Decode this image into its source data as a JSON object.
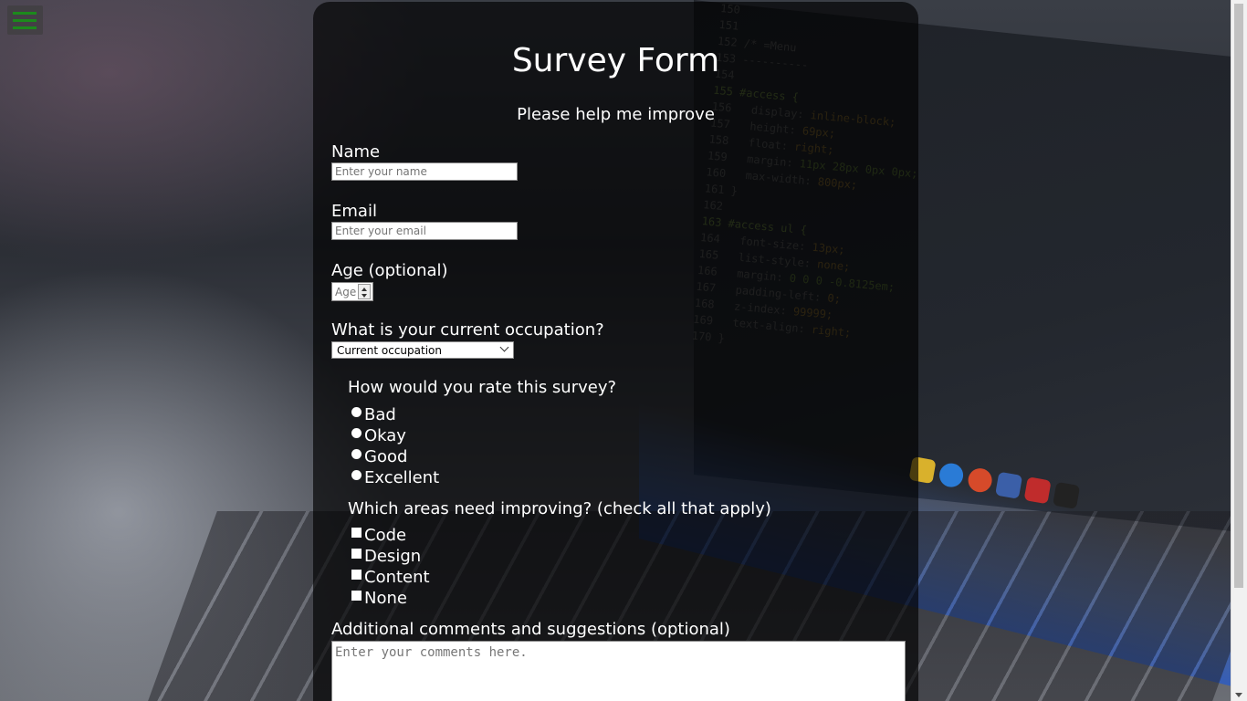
{
  "menu": {
    "icon": "hamburger-icon"
  },
  "form": {
    "title": "Survey Form",
    "subtitle": "Please help me improve",
    "name": {
      "label": "Name",
      "placeholder": "Enter your name"
    },
    "email": {
      "label": "Email",
      "placeholder": "Enter your email"
    },
    "age": {
      "label": "Age (optional)",
      "placeholder": "Age"
    },
    "occupation": {
      "label": "What is your current occupation?",
      "selected": "Current occupation"
    },
    "rating": {
      "question": "How would you rate this survey?",
      "options": [
        "Bad",
        "Okay",
        "Good",
        "Excellent"
      ]
    },
    "improve": {
      "question": "Which areas need improving? (check all that apply)",
      "options": [
        "Code",
        "Design",
        "Content",
        "None"
      ]
    },
    "comments": {
      "label": "Additional comments and suggestions (optional)",
      "placeholder": "Enter your comments here."
    }
  },
  "colors": {
    "menu_accent": "#1c8a1c",
    "panel_bg": "rgba(0,0,0,0.66)"
  }
}
